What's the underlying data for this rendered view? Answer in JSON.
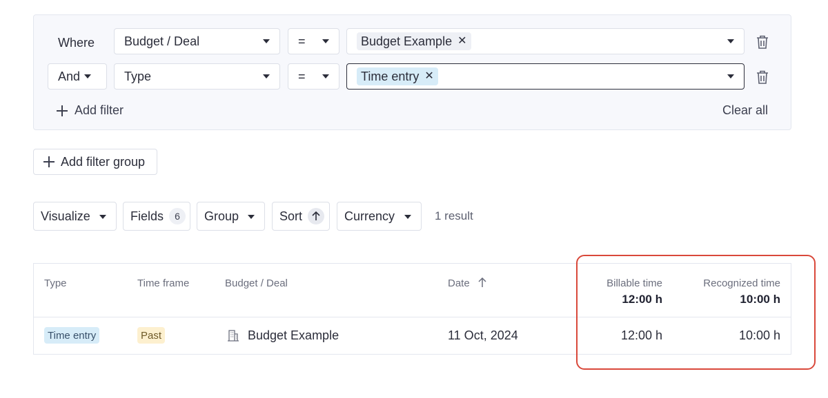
{
  "filters": {
    "rows": [
      {
        "connector": "Where",
        "field": "Budget / Deal",
        "operator": "=",
        "value_chip": "Budget Example"
      },
      {
        "connector": "And",
        "field": "Type",
        "operator": "=",
        "value_chip": "Time entry"
      }
    ],
    "add_filter": "Add filter",
    "clear_all": "Clear all"
  },
  "add_filter_group": "Add filter group",
  "toolbar": {
    "visualize": "Visualize",
    "fields": "Fields",
    "fields_count": "6",
    "group": "Group",
    "sort": "Sort",
    "currency": "Currency",
    "result_count": "1 result"
  },
  "table": {
    "headers": {
      "type": "Type",
      "time_frame": "Time frame",
      "budget_deal": "Budget / Deal",
      "date": "Date",
      "billable_time": "Billable time",
      "recognized_time": "Recognized time"
    },
    "totals": {
      "billable_time": "12:00 h",
      "recognized_time": "10:00 h"
    },
    "rows": [
      {
        "type": "Time entry",
        "time_frame": "Past",
        "budget_deal": "Budget Example",
        "date": "11 Oct, 2024",
        "billable_time": "12:00 h",
        "recognized_time": "10:00 h"
      }
    ]
  },
  "colors": {
    "highlight": "#d9483a",
    "tag_blue": "#d7ecf8",
    "tag_yellow": "#fdf0cf"
  },
  "icons": [
    "trash-icon",
    "plus-icon",
    "chevron-down-icon",
    "arrow-up-icon",
    "building-icon",
    "close-icon"
  ]
}
